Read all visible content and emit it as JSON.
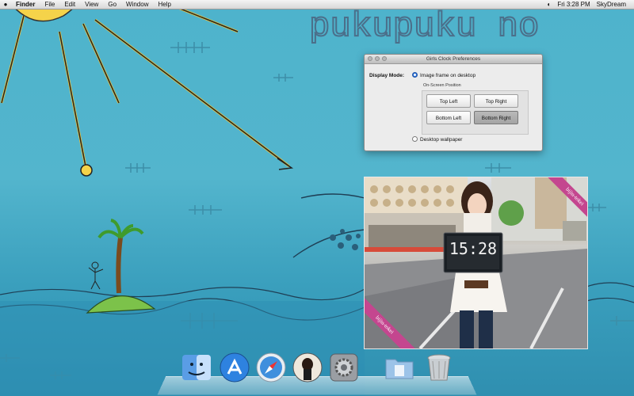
{
  "menubar": {
    "apple_icon": "apple-icon",
    "items": [
      "Finder",
      "File",
      "Edit",
      "View",
      "Go",
      "Window",
      "Help"
    ],
    "clock": "Fri 3:28 PM",
    "user": "SkyDream"
  },
  "wallpaper": {
    "title_text": "puku puku no"
  },
  "prefs_window": {
    "title": "Girls Clock Preferences",
    "display_mode_label": "Display Mode:",
    "option_image_frame": "Image frame on desktop",
    "option_desktop_wallpaper": "Desktop wallpaper",
    "selected_mode": "Image frame on desktop",
    "position_group_label": "On-Screen Position",
    "positions": {
      "top_left": "Top Left",
      "top_right": "Top Right",
      "bottom_left": "Bottom Left",
      "bottom_right": "Bottom Right"
    },
    "selected_position": "Bottom Right"
  },
  "photo_frame": {
    "board_time": "15:28",
    "ribbon_top": "bijin-tokei",
    "ribbon_bottom": "bijin-tokei"
  },
  "dock": {
    "items": [
      "finder-icon",
      "app-store-icon",
      "safari-icon",
      "girls-clock-icon",
      "system-preferences-icon",
      "documents-folder-icon",
      "trash-icon"
    ]
  },
  "colors": {
    "sky": "#4eb3cc",
    "sea": "#2f8fb0",
    "ribbon": "#c4468f",
    "radio_on": "#2b6fd6"
  }
}
